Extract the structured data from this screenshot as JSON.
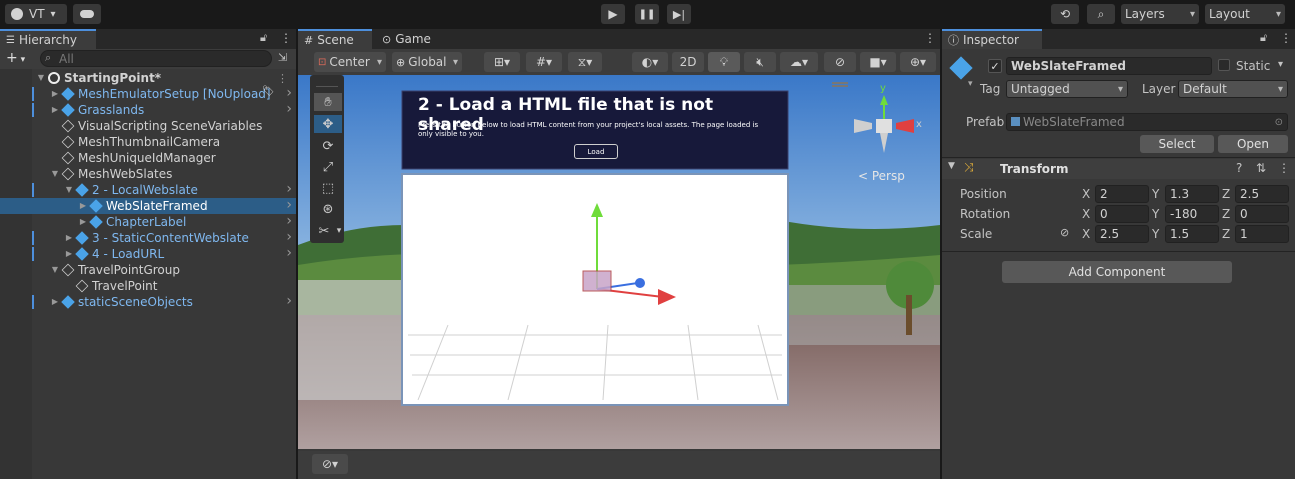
{
  "topbar": {
    "account_label": "VT",
    "history_icon": "history-icon",
    "search_icon": "search-icon",
    "layers_label": "Layers",
    "layout_label": "Layout"
  },
  "hierarchy": {
    "tab_label": "Hierarchy",
    "add_label": "+",
    "search_placeholder": "All",
    "items": [
      {
        "label": "StartingPoint*",
        "bold": true
      },
      {
        "label": "MeshEmulatorSetup [NoUpload]"
      },
      {
        "label": "Grasslands"
      },
      {
        "label": "VisualScripting SceneVariables"
      },
      {
        "label": "MeshThumbnailCamera"
      },
      {
        "label": "MeshUniqueIdManager"
      },
      {
        "label": "MeshWebSlates"
      },
      {
        "label": "2 - LocalWebslate"
      },
      {
        "label": "WebSlateFramed"
      },
      {
        "label": "ChapterLabel"
      },
      {
        "label": "3 - StaticContentWebslate"
      },
      {
        "label": "4 - LoadURL"
      },
      {
        "label": "TravelPointGroup"
      },
      {
        "label": "TravelPoint"
      },
      {
        "label": "staticSceneObjects"
      }
    ]
  },
  "scene": {
    "tab_scene": "Scene",
    "tab_game": "Game",
    "pivot_label": "Center",
    "space_label": "Global",
    "mode_2d": "2D",
    "persp_label": "< Persp",
    "gizmo_y": "y",
    "gizmo_x": "x",
    "webslate_title": "2 - Load a HTML file that is not shared",
    "webslate_desc": "Press the button below to load HTML content from your project's local assets. The page loaded is only visible to you.",
    "webslate_button": "Load"
  },
  "inspector": {
    "tab_label": "Inspector",
    "object_name": "WebSlateFramed",
    "static_label": "Static",
    "tag_label": "Tag",
    "tag_value": "Untagged",
    "layer_label": "Layer",
    "layer_value": "Default",
    "prefab_label": "Prefab",
    "prefab_value": "WebSlateFramed",
    "select_label": "Select",
    "open_label": "Open",
    "transform_label": "Transform",
    "position_label": "Position",
    "rotation_label": "Rotation",
    "scale_label": "Scale",
    "axis_x": "X",
    "axis_y": "Y",
    "axis_z": "Z",
    "position": {
      "x": "2",
      "y": "1.3",
      "z": "2.5"
    },
    "rotation": {
      "x": "0",
      "y": "-180",
      "z": "0"
    },
    "scale": {
      "x": "2.5",
      "y": "1.5",
      "z": "1"
    },
    "add_component_label": "Add Component"
  },
  "colors": {
    "accent": "#4d8fdc",
    "selection": "#2c5d87",
    "prefab_blue": "#7fb8f0"
  }
}
